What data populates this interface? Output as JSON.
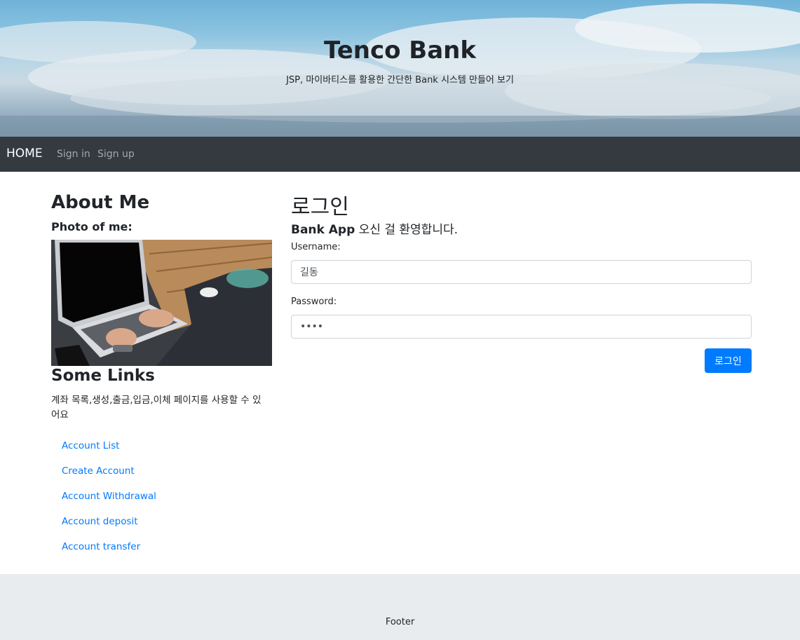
{
  "header": {
    "title": "Tenco Bank",
    "subtitle": "JSP, 마이바티스를 활용한 간단한 Bank 시스템 만들어 보기"
  },
  "nav": {
    "brand": "HOME",
    "links": [
      "Sign in",
      "Sign up"
    ]
  },
  "sidebar": {
    "about_heading": "About Me",
    "photo_heading": "Photo of me:",
    "links_heading": "Some Links",
    "links_description": "계좌 목록,생성,출금,입금,이체 페이지를 사용할 수 있어요",
    "links": [
      "Account List",
      "Create Account",
      "Account Withdrawal",
      "Account deposit",
      "Account transfer"
    ]
  },
  "login": {
    "heading": "로그인",
    "welcome_bold": "Bank App",
    "welcome_rest": " 오신 걸 환영합니다.",
    "username_label": "Username:",
    "username_value": "길동",
    "password_label": "Password:",
    "password_value": "••••",
    "submit_label": "로그인"
  },
  "footer": {
    "text": "Footer"
  },
  "colors": {
    "navbar": "#343a40",
    "primary": "#007bff",
    "footer": "#e9ecef"
  }
}
